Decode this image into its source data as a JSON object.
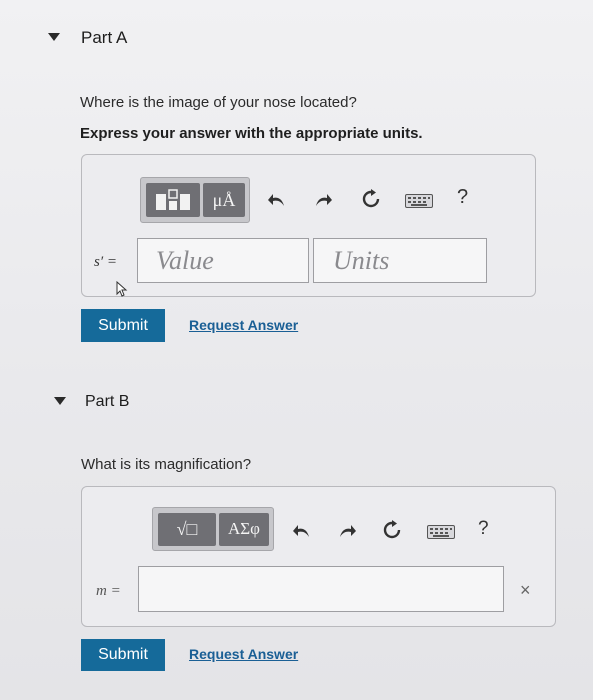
{
  "part_a": {
    "title": "Part A",
    "question": "Where is the image of your nose located?",
    "instruction": "Express your answer with the appropriate units.",
    "toolbar": {
      "units_symbol": "μÅ",
      "help": "?"
    },
    "variable_label": "s′ =",
    "value_placeholder": "Value",
    "units_placeholder": "Units",
    "submit_label": "Submit",
    "request_label": "Request Answer"
  },
  "part_b": {
    "title": "Part B",
    "question": "What is its magnification?",
    "toolbar": {
      "radical_symbol": "√□",
      "greek_symbol": "ΑΣφ",
      "help": "?"
    },
    "variable_label": "m =",
    "clear": "×",
    "submit_label": "Submit",
    "request_label": "Request Answer"
  },
  "icons": [
    "caret-down-icon",
    "undo-icon",
    "redo-icon",
    "reset-icon",
    "keyboard-icon",
    "help-icon",
    "cursor-icon",
    "clear-icon"
  ],
  "colors": {
    "submit": "#156a9a",
    "link": "#1a5f95"
  }
}
